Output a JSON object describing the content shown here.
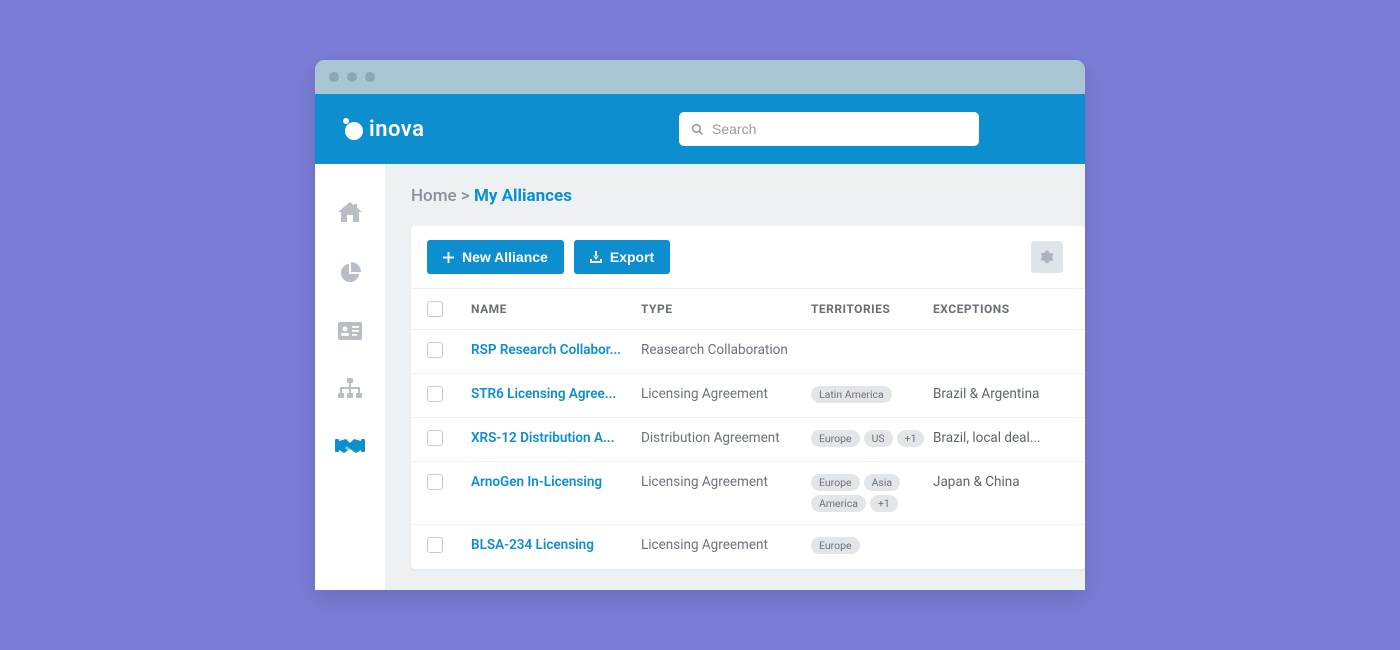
{
  "brand": {
    "name": "inova"
  },
  "search": {
    "placeholder": "Search"
  },
  "sidebar": {
    "items": [
      {
        "name": "home",
        "active": false
      },
      {
        "name": "analytics",
        "active": false
      },
      {
        "name": "contacts",
        "active": false
      },
      {
        "name": "org-chart",
        "active": false
      },
      {
        "name": "alliances",
        "active": true
      }
    ]
  },
  "breadcrumb": {
    "root": "Home",
    "separator": ">",
    "current": "My Alliances"
  },
  "toolbar": {
    "new_label": "New Alliance",
    "export_label": "Export"
  },
  "columns": {
    "name": "NAME",
    "type": "TYPE",
    "territories": "TERRITORIES",
    "exceptions": "EXCEPTIONS"
  },
  "rows": [
    {
      "name": "RSP Research Collabor...",
      "type": "Reasearch Collaboration",
      "territories": [],
      "exceptions": ""
    },
    {
      "name": "STR6 Licensing Agree...",
      "type": "Licensing Agreement",
      "territories": [
        "Latin America"
      ],
      "exceptions": "Brazil & Argentina"
    },
    {
      "name": "XRS-12 Distribution A...",
      "type": "Distribution Agreement",
      "territories": [
        "Europe",
        "US",
        "+1"
      ],
      "exceptions": "Brazil, local deal..."
    },
    {
      "name": "ArnoGen In-Licensing",
      "type": "Licensing Agreement",
      "territories": [
        "Europe",
        "Asia",
        "America",
        "+1"
      ],
      "exceptions": "Japan & China"
    },
    {
      "name": "BLSA-234 Licensing",
      "type": "Licensing Agreement",
      "territories": [
        "Europe"
      ],
      "exceptions": ""
    }
  ],
  "colors": {
    "accent": "#0d8ecf",
    "bg": "#7a7cd6"
  }
}
